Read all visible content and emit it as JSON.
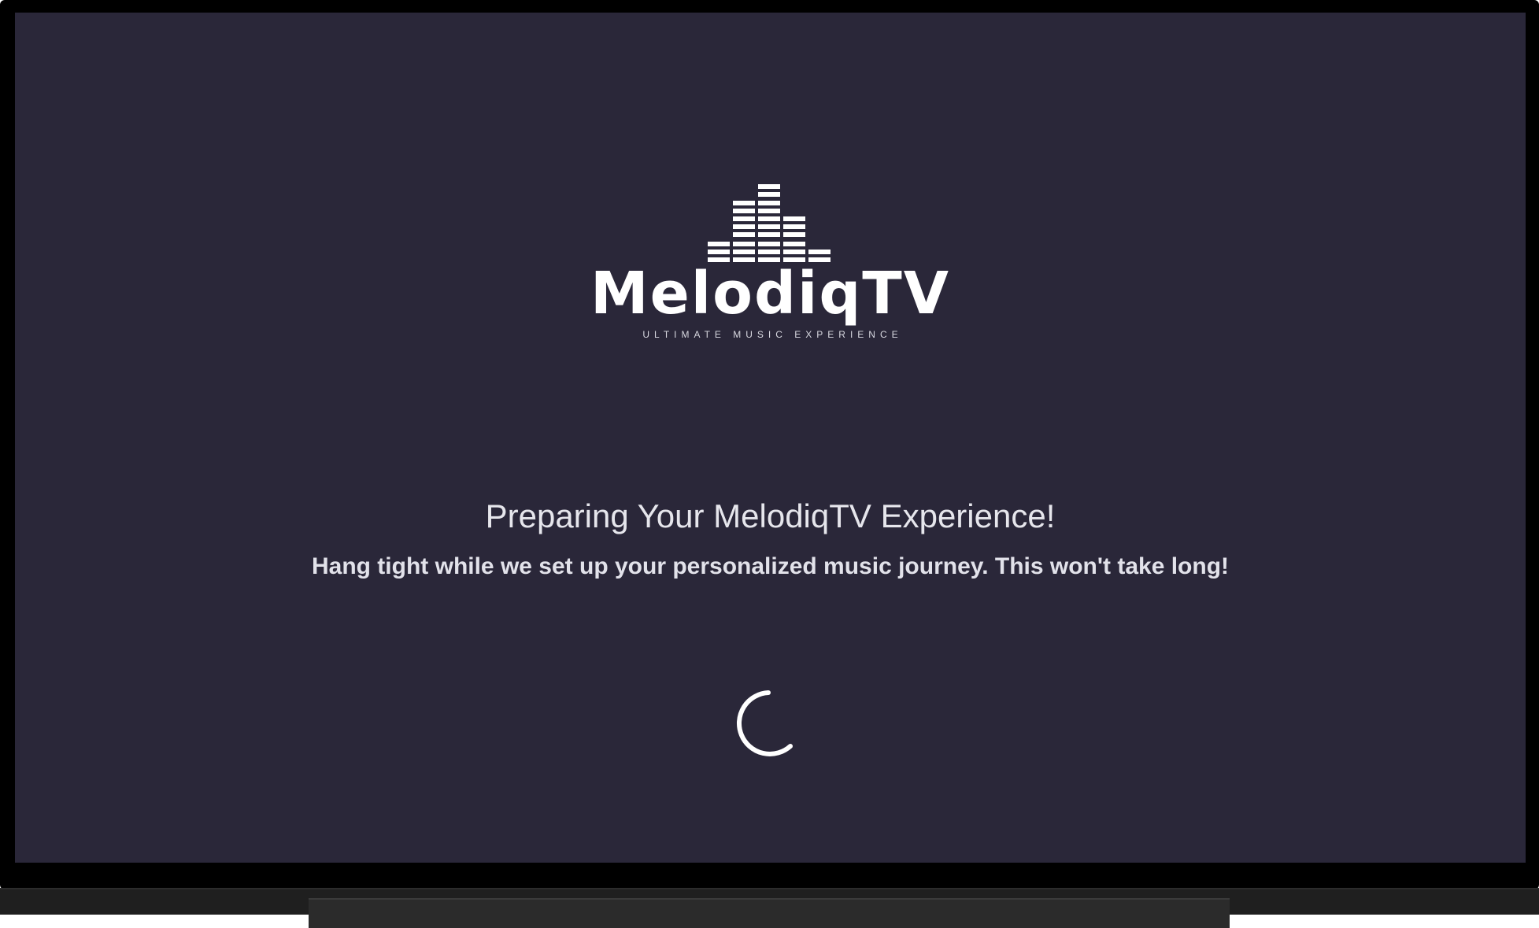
{
  "app": {
    "name": "MelodiqTV",
    "tagline": "ULTIMATE MUSIC EXPERIENCE"
  },
  "loading": {
    "title": "Preparing Your MelodiqTV Experience!",
    "message": "Hang tight while we set up your personalized music journey. This won't take long!"
  },
  "icons": {
    "logo": "equalizer-bars-icon",
    "spinner": "loading-spinner-icon"
  },
  "colors": {
    "screen_background": "#2a2739",
    "text_primary": "#ffffff",
    "bezel": "#000000"
  }
}
